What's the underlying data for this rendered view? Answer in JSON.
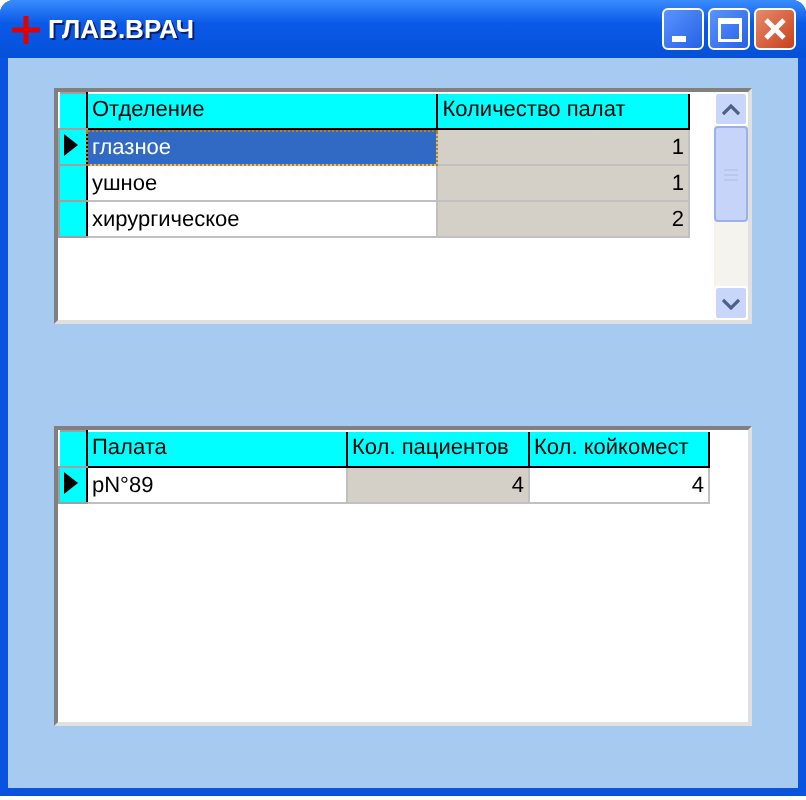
{
  "window": {
    "title": "ГЛАВ.ВРАЧ"
  },
  "grids": [
    {
      "focused": true,
      "scrollbar": true,
      "columns": [
        {
          "label": "Отделение",
          "readonly": false,
          "kind": "text"
        },
        {
          "label": "Количество палат",
          "readonly": true,
          "kind": "number"
        }
      ],
      "rows": [
        {
          "selected": true,
          "cells": [
            "глазное",
            "1"
          ]
        },
        {
          "selected": false,
          "cells": [
            "ушное",
            "1"
          ]
        },
        {
          "selected": false,
          "cells": [
            "хирургическое",
            "2"
          ]
        }
      ]
    },
    {
      "focused": false,
      "columns": [
        {
          "label": "Палата",
          "readonly": false,
          "kind": "text"
        },
        {
          "label": "Кол. пациентов",
          "readonly": true,
          "kind": "number"
        },
        {
          "label": "Кол. койкомест",
          "readonly": false,
          "kind": "number"
        }
      ],
      "rows": [
        {
          "selected": true,
          "cells": [
            "рN°89",
            "4",
            "4"
          ]
        }
      ]
    }
  ]
}
